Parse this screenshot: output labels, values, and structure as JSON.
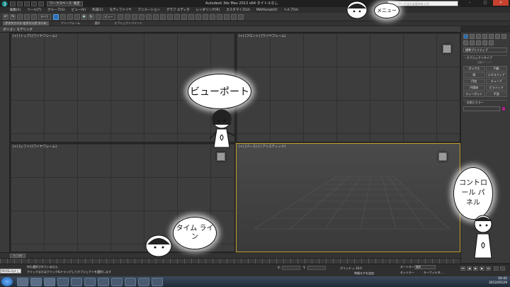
{
  "titlebar": {
    "workspace": "ワークスペース: 既定",
    "title": "Autodesk 3ds Max  2013 x64     タイトルなし",
    "help_search_placeholder": "キーワードまたは語句を入力",
    "minimize": "–",
    "maximize": "□",
    "close": "✕"
  },
  "menubar": {
    "items": [
      "編集(E)",
      "ツール(T)",
      "グループ(G)",
      "ビュー(V)",
      "作成(C)",
      "モディファイヤ",
      "アニメーション",
      "グラフ エディタ",
      "レンダリング(R)",
      "カスタマイズ(U)",
      "MAXScript(X)",
      "ヘルプ(H)"
    ]
  },
  "toolbar": {
    "selection_filter": "すべて",
    "view_select": "ビュー"
  },
  "ribbon": {
    "tabs": [
      "グラファイト モデリング ツール",
      "フリーフォーム",
      "選択",
      "オブジェクトペイント"
    ],
    "panel_label": "ポリゴン モデリング"
  },
  "viewports": {
    "top_label": "[+] [トップ] [ワイヤフレーム]",
    "front_label": "[+] [フロント] [ワイヤフレーム]",
    "left_label": "[+] [レフト] [ワイヤフレーム]",
    "persp_label": "[+] [パース] [リアリスティック]"
  },
  "command_panel": {
    "category_dropdown": "標準プリミティブ",
    "rollout_object_type": "- オブジェクトタイプ",
    "autogrid": "自動グリッド",
    "objects": [
      "ボックス",
      "円錐",
      "球",
      "ジオスフィア",
      "円柱",
      "チューブ",
      "円環体",
      "ピラミッド",
      "ティーポット",
      "平面"
    ],
    "rollout_name_color": "- 名前とカラー"
  },
  "timeline": {
    "slider": "0 / 100"
  },
  "statusbar": {
    "maxscript": "MAXScript によう",
    "line1": "何も選択されていません",
    "line2": "クリックまたはクリック&ドラッグしてオブジェクトを選択します",
    "x_label": "X:",
    "y_label": "Y:",
    "z_label": "Z:",
    "grid": "グリッド = 10.0",
    "add_time_tag": "時間タグを追加",
    "auto_key": "オートキー",
    "auto_key_select": "選択",
    "set_key": "セットキー",
    "key_filters": "キーフィルタ..."
  },
  "taskbar": {
    "time": "16:42",
    "date": "2012/05/29"
  },
  "annotations": {
    "viewport": "ビューポート",
    "timeline": "タイム ライン",
    "control_panel": "コントロール パネル",
    "menu": "メニュー"
  },
  "colors": {
    "accent_blue": "#2a6fb2",
    "active_viewport_border": "#c8a030",
    "color_swatch": "#b0208a"
  }
}
